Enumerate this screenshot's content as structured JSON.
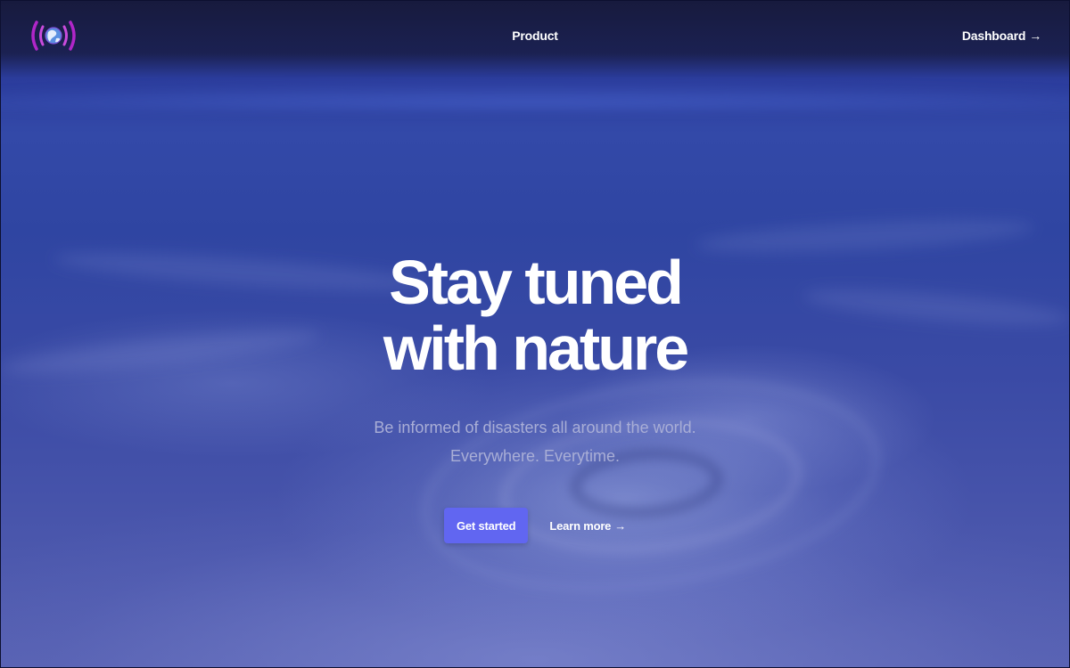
{
  "header": {
    "logo_icon": "radio-broadcast-globe-icon",
    "nav_product": "Product",
    "nav_dashboard": "Dashboard",
    "arrow": "→"
  },
  "hero": {
    "title_line1": "Stay tuned",
    "title_line2": "with nature",
    "subtitle_line1": "Be informed of disasters all around the world.",
    "subtitle_line2": "Everywhere. Everytime."
  },
  "cta": {
    "primary_label": "Get started",
    "secondary_label": "Learn more",
    "arrow": "→"
  },
  "colors": {
    "accent": "#6166f1",
    "logo_magenta": "#b026c9",
    "subtitle": "#a9aed6"
  }
}
